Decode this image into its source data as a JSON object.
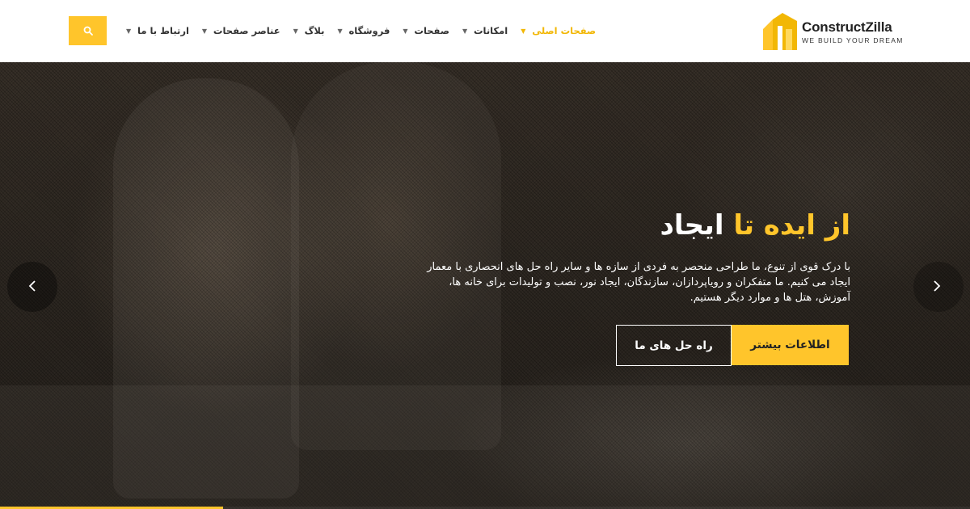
{
  "brand": {
    "name": "ConstructZilla",
    "tagline": "WE BUILD YOUR DREAM",
    "accent_color": "#ffc52b"
  },
  "header": {
    "search_icon": "search-icon",
    "nav": [
      {
        "label": "ارتباط با ما",
        "has_dropdown": true,
        "active": false
      },
      {
        "label": "عناصر صفحات",
        "has_dropdown": true,
        "active": false
      },
      {
        "label": "بلاگ",
        "has_dropdown": true,
        "active": false
      },
      {
        "label": "فروشگاه",
        "has_dropdown": true,
        "active": false
      },
      {
        "label": "صفحات",
        "has_dropdown": true,
        "active": false
      },
      {
        "label": "امکانات",
        "has_dropdown": true,
        "active": false
      },
      {
        "label": "صفحات اصلی",
        "has_dropdown": true,
        "active": true
      }
    ]
  },
  "hero": {
    "title_plain": "ایجاد",
    "title_accent": "از ایده تا",
    "description": "با درک قوی از تنوع، ما طراحی منحصر به فردی از سازه ها و سایر راه حل های انحصاری با معمار ایجاد می کنیم. ما متفکران و رویاپردازان، سازندگان، ایجاد نور، نصب و تولیدات برای خانه ها، آموزش، هتل ها و موارد دیگر هستیم.",
    "primary_button": "اطلاعات بیشتر",
    "secondary_button": "راه حل های ما",
    "prev_icon": "chevron-left-icon",
    "next_icon": "chevron-right-icon",
    "slide_progress": 0.23
  }
}
